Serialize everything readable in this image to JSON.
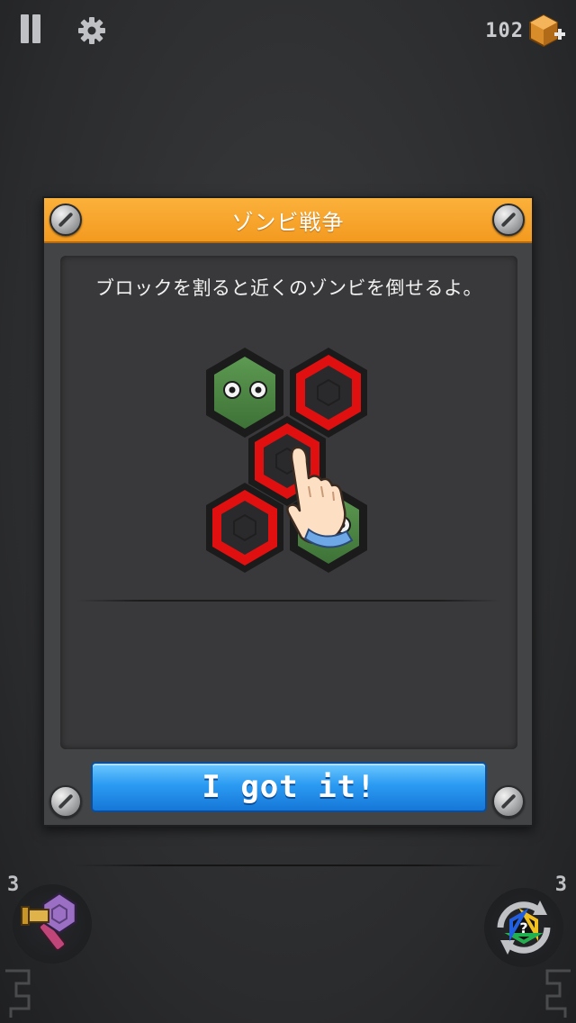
{
  "topbar": {
    "pause_icon": "pause-icon",
    "settings_icon": "gear-icon",
    "block_count": "102",
    "block_icon": "hex-block-plus-icon"
  },
  "dialog": {
    "title": "ゾンビ戦争",
    "instruction": "ブロックを割ると近くのゾンビを倒せるよ。",
    "confirm_label": "I got it!",
    "illustration": "hex-zombie-tap-tutorial",
    "colors": {
      "header": "#f7a52c",
      "button": "#2b9bf2",
      "hex_red": "#e01010",
      "zombie_green": "#4e8a45"
    }
  },
  "powerups": {
    "hammer_count": "3",
    "hammer_icon": "hammer-icon",
    "swap_count": "3",
    "swap_icon": "rainbow-swap-icon"
  }
}
